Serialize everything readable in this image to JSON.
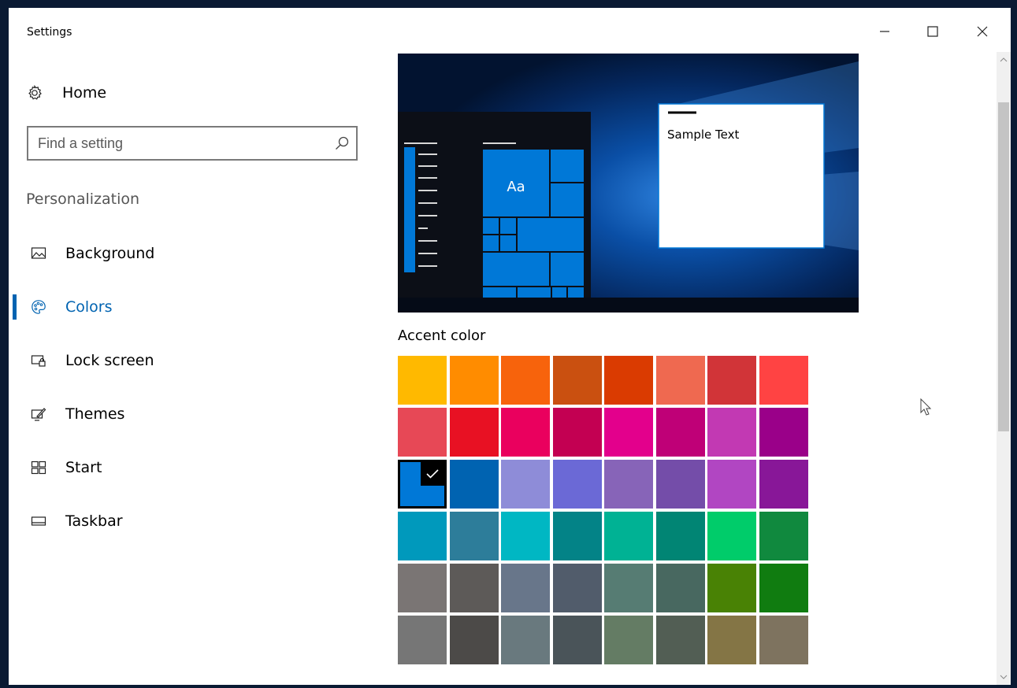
{
  "window": {
    "title": "Settings",
    "controls": [
      "minimize-icon",
      "maximize-icon",
      "close-icon"
    ]
  },
  "sidebar": {
    "home_label": "Home",
    "search": {
      "placeholder": "Find a setting",
      "value": ""
    },
    "section_title": "Personalization",
    "items": [
      {
        "label": "Background",
        "icon": "picture-icon",
        "selected": false
      },
      {
        "label": "Colors",
        "icon": "palette-icon",
        "selected": true
      },
      {
        "label": "Lock screen",
        "icon": "lock-screen-icon",
        "selected": false
      },
      {
        "label": "Themes",
        "icon": "themes-icon",
        "selected": false
      },
      {
        "label": "Start",
        "icon": "start-tiles-icon",
        "selected": false
      },
      {
        "label": "Taskbar",
        "icon": "taskbar-icon",
        "selected": false
      }
    ]
  },
  "preview": {
    "sample_text": "Sample Text",
    "tile_text": "Aa",
    "accent": "#0078d7"
  },
  "accent_color": {
    "title": "Accent color",
    "selected_index": 16,
    "colors": [
      "#ffb900",
      "#ff8c00",
      "#f7630c",
      "#ca5010",
      "#da3b01",
      "#ef6950",
      "#d13438",
      "#ff4343",
      "#e74856",
      "#e81123",
      "#ea005e",
      "#c30052",
      "#e3008c",
      "#bf0077",
      "#c239b3",
      "#9a0089",
      "#0078d7",
      "#0063b1",
      "#8e8cd8",
      "#6b69d6",
      "#8764b8",
      "#744da9",
      "#b146c2",
      "#881798",
      "#0099bc",
      "#2d7d9a",
      "#00b7c3",
      "#038387",
      "#00b294",
      "#018574",
      "#00cc6a",
      "#10893e",
      "#7a7574",
      "#5d5a58",
      "#68768a",
      "#515c6b",
      "#567c73",
      "#486860",
      "#498205",
      "#107c10",
      "#767676",
      "#4c4a48",
      "#69797e",
      "#4a5459",
      "#647c64",
      "#525e54",
      "#847545",
      "#7e735f"
    ]
  }
}
